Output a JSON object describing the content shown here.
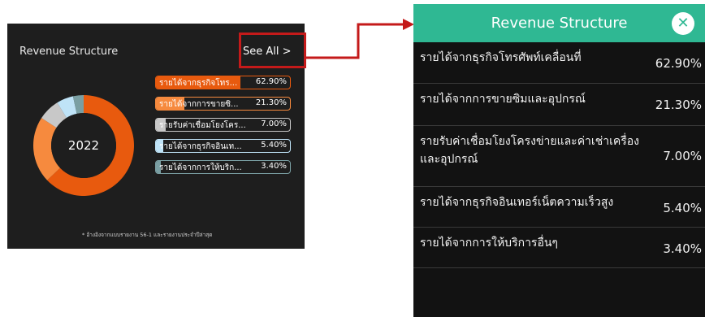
{
  "card": {
    "title": "Revenue Structure",
    "see_all": "See All >",
    "year": "2022",
    "footnote": "* อ้างอิงจากแบบรายงาน 56-1 และรายงานประจำปีล่าสุด"
  },
  "panel": {
    "title": "Revenue Structure",
    "close_icon": "close-icon"
  },
  "colors": {
    "accent": "#2fb893",
    "highlight": "#c41a1a"
  },
  "chart_data": {
    "type": "pie",
    "center_label": "2022",
    "categories": [
      "รายได้จากธุรกิจโทรศัพท์เคลื่อนที่",
      "รายได้จากการขายซิมและอุปกรณ์",
      "รายรับค่าเชื่อมโยงโครงข่ายและค่าเช่าเครื่องและอุปกรณ์",
      "รายได้จากธุรกิจอินเทอร์เน็ตความเร็วสูง",
      "รายได้จากการให้บริการอื่นๆ"
    ],
    "values": [
      62.9,
      21.3,
      7.0,
      5.4,
      3.4
    ],
    "colors": [
      "#e85a0e",
      "#f68a3e",
      "#c8c8c8",
      "#bfe3f7",
      "#7a9fa3"
    ]
  },
  "legend": [
    {
      "label": "รายได้จากธุรกิจโทร...",
      "value": "62.90%",
      "color": "#e85a0e",
      "pct": 62.9
    },
    {
      "label": "รายได้จากการขายซิ...",
      "value": "21.30%",
      "color": "#f68a3e",
      "pct": 21.3
    },
    {
      "label": "รายรับค่าเชื่อมโยงโคร...",
      "value": "7.00%",
      "color": "#c8c8c8",
      "pct": 7.0
    },
    {
      "label": "รายได้จากธุรกิจอินเท...",
      "value": "5.40%",
      "color": "#bfe3f7",
      "pct": 5.4
    },
    {
      "label": "รายได้จากการให้บริก...",
      "value": "3.40%",
      "color": "#7a9fa3",
      "pct": 3.4
    }
  ],
  "rows": [
    {
      "label": "รายได้จากธุรกิจโทรศัพท์เคลื่อนที่",
      "value": "62.90%"
    },
    {
      "label": "รายได้จากการขายซิมและอุปกรณ์",
      "value": "21.30%"
    },
    {
      "label": "รายรับค่าเชื่อมโยงโครงข่ายและค่าเช่าเครื่องและอุปกรณ์",
      "value": "7.00%"
    },
    {
      "label": "รายได้จากธุรกิจอินเทอร์เน็ตความเร็วสูง",
      "value": "5.40%"
    },
    {
      "label": "รายได้จากการให้บริการอื่นๆ",
      "value": "3.40%"
    }
  ]
}
